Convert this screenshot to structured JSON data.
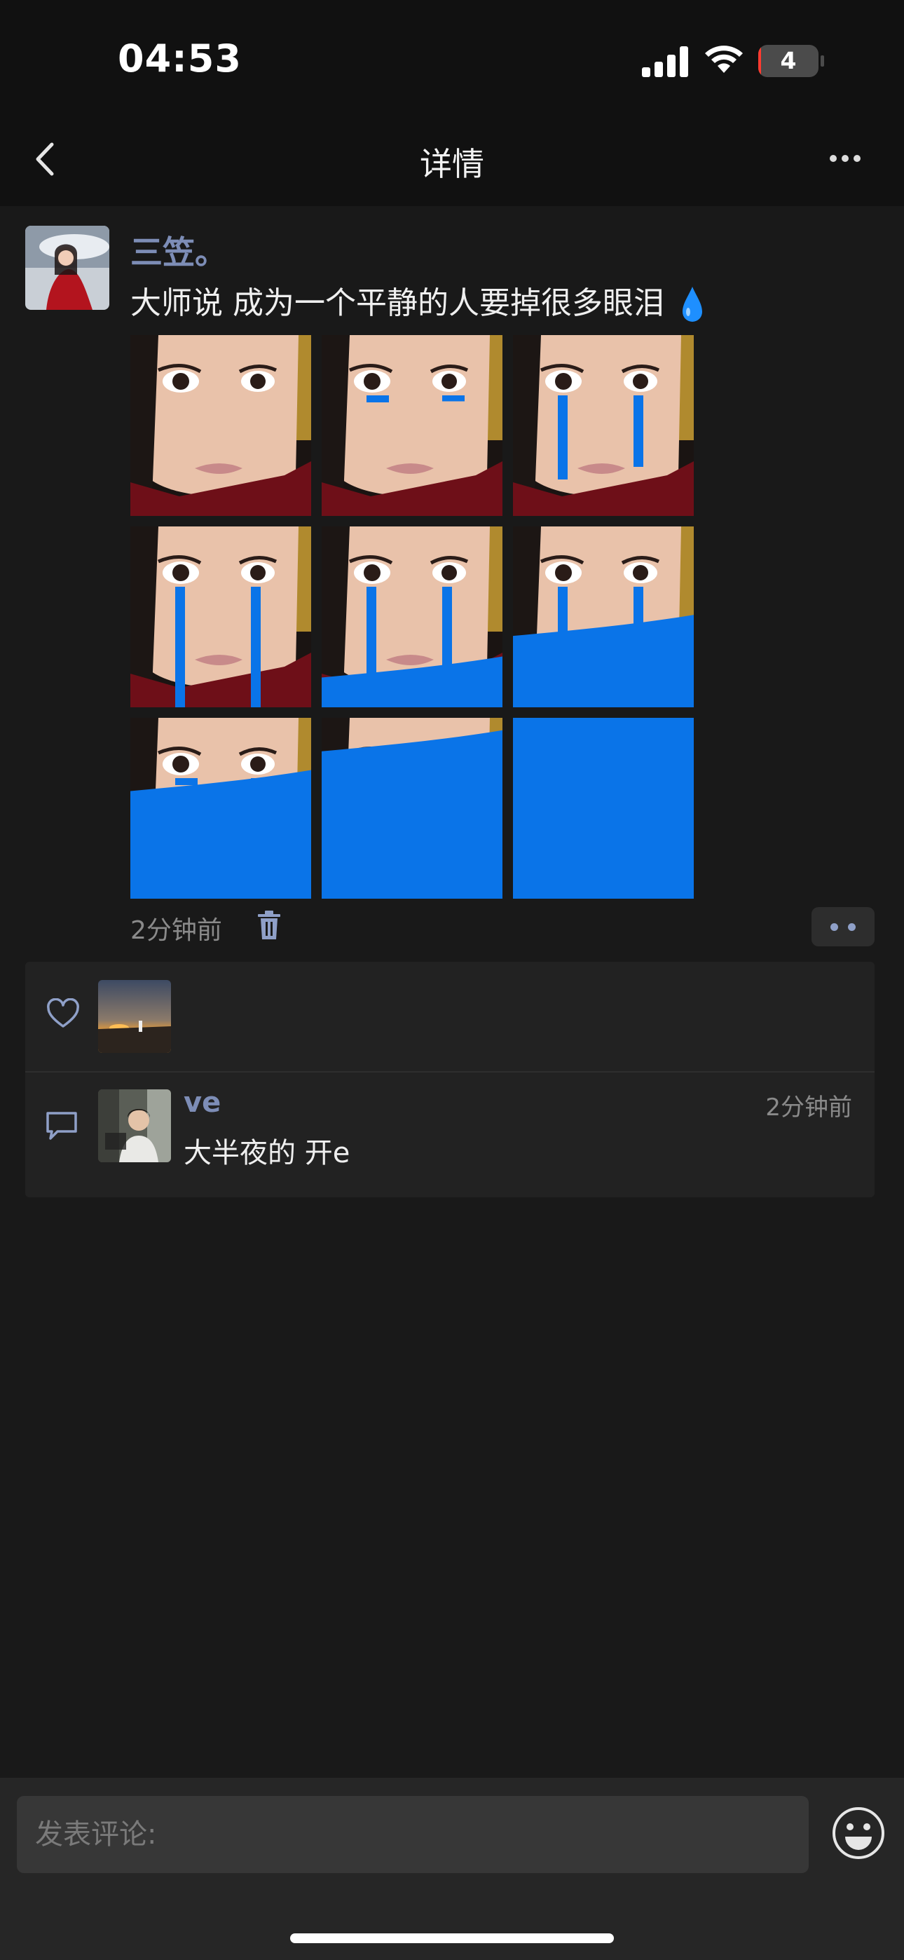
{
  "status_bar": {
    "time": "04:53",
    "battery_level": "4",
    "battery_fraction": 0.04,
    "battery_color": "#ff3b30"
  },
  "nav": {
    "title": "详情",
    "back_icon": "chevron-left-icon",
    "more_icon": "ellipsis-icon"
  },
  "post": {
    "author": "三笠。",
    "text": "大师说 成为一个平静的人要掉很多眼泪",
    "emoji": "droplet-icon",
    "time": "2分钟前",
    "delete_icon": "trash-icon",
    "image_count": 9,
    "images": [
      {
        "tears": "none",
        "flood": 0
      },
      {
        "tears": "small",
        "flood": 0
      },
      {
        "tears": "medium",
        "flood": 0
      },
      {
        "tears": "long",
        "flood": 0
      },
      {
        "tears": "long",
        "flood": 0.25
      },
      {
        "tears": "long",
        "flood": 0.48
      },
      {
        "tears": "small",
        "flood": 0.68
      },
      {
        "tears": "none",
        "flood": 0.9
      },
      {
        "tears": "none",
        "flood": 1
      }
    ]
  },
  "likes": {
    "icon": "heart-icon",
    "users": [
      {
        "avatar": "sunset-avatar"
      }
    ]
  },
  "comments": [
    {
      "icon": "comment-icon",
      "user": "ve",
      "time": "2分钟前",
      "text": "大半夜的 开e",
      "avatar": "man-avatar"
    }
  ],
  "composer": {
    "placeholder": "发表评论:",
    "emoji_icon": "smiley-icon"
  },
  "colors": {
    "background": "#191919",
    "accent_name": "#7d8db6",
    "tear_blue": "#0a74e8"
  }
}
